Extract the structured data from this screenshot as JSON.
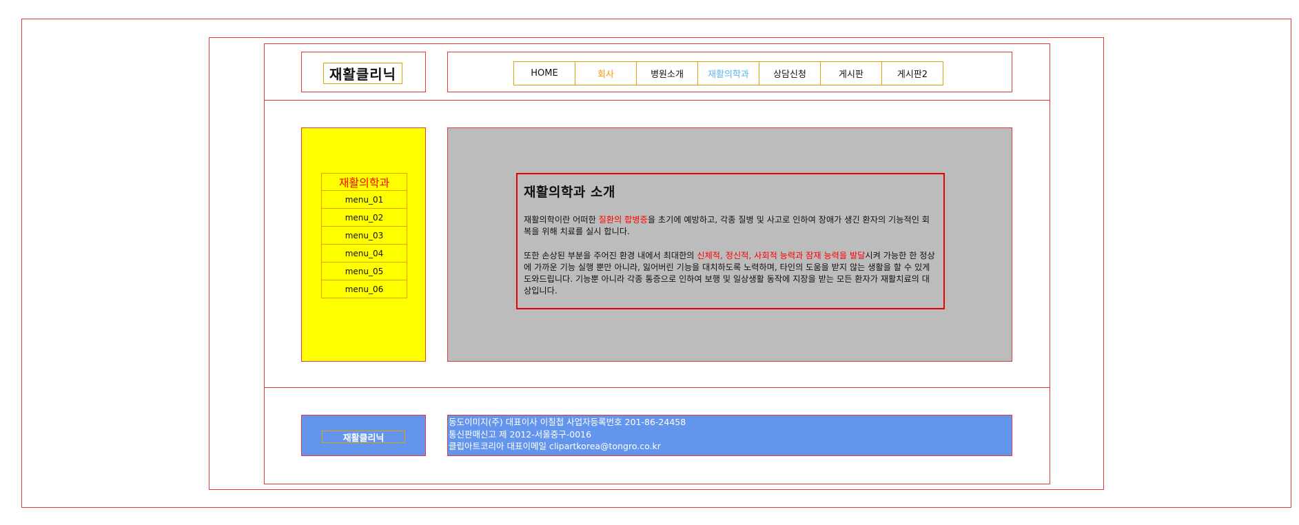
{
  "logo": {
    "text": "재활클리닉"
  },
  "nav": {
    "items": [
      {
        "label": "HOME",
        "color": "#111111"
      },
      {
        "label": "회사",
        "color": "#f59b00"
      },
      {
        "label": "병원소개",
        "color": "#111111"
      },
      {
        "label": "재활의학과",
        "color": "#5ab4f0"
      },
      {
        "label": "상담신청",
        "color": "#111111"
      },
      {
        "label": "게시판",
        "color": "#111111"
      },
      {
        "label": "게시판2",
        "color": "#111111"
      }
    ]
  },
  "sidebar": {
    "title": "재활의학과",
    "items": [
      "menu_01",
      "menu_02",
      "menu_03",
      "menu_04",
      "menu_05",
      "menu_06"
    ]
  },
  "content": {
    "title": "재활의학과 소개",
    "p1_before": "재활의학이란 어떠한 ",
    "p1_highlight": "질환의 합병증",
    "p1_after": "을 초기에 예방하고, 각종 질병 및 사고로 인하여 장애가 생긴 환자의 기능적인 회복을 위해 치료를 실시 합니다.",
    "p2_before": "또한 손상된 부분을 주어진 환경 내에서 최대한의 ",
    "p2_highlight": "신체적, 정신적, 사회적 능력과 잠재 능력을 발달",
    "p2_after": "시켜 가능한 한 정상에 가까운 기능 실행 뿐만 아니라, 잃어버린 기능을 대치하도록 노력하며, 타인의 도움을 받지 않는 생활을 할 수 있게 도와드립니다. 기능뿐 아니라 각종 통증으로 인하여 보행 및 일상생활 동작에 지장을 받는 모든 환자가 재활치료의 대상입니다."
  },
  "footer": {
    "logo": "재활클리닉",
    "line1": "동도이미지(주) 대표이사 이칠첩 사업자등록번호 201-86-24458",
    "line2": "통신판매신고 제 2012-서울중구-0016",
    "line3": "클립아트코리아 대표이메일 clipartkorea@tongro.co.kr"
  }
}
